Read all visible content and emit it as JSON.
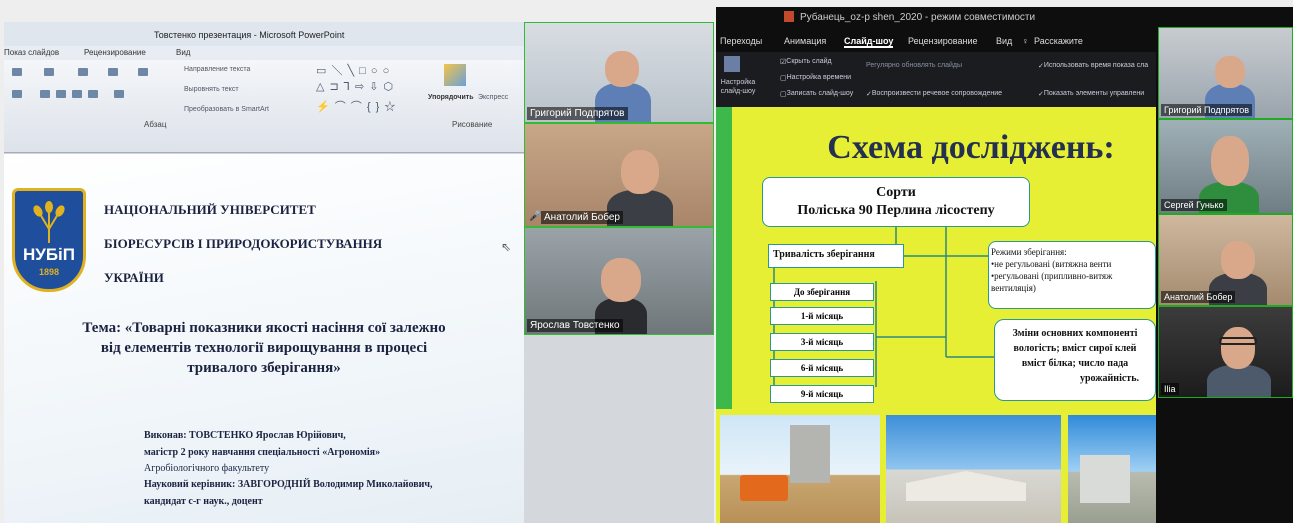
{
  "left": {
    "window_title": "Товстенко презентация  -  Microsoft PowerPoint",
    "tabs": [
      "Показ слайдов",
      "Рецензирование",
      "Вид"
    ],
    "ribbon": {
      "text_direction": "Направление текста",
      "align_text": "Выровнять текст",
      "convert_smartart": "Преобразовать в SmartArt",
      "arrange": "Упорядочить",
      "express": "Экспресс",
      "group_paragraph": "Абзац",
      "group_drawing": "Рисование"
    },
    "slide": {
      "logo_text": "НУБіП",
      "logo_year": "1898",
      "university_line1": "НАЦІОНАЛЬНИЙ УНІВЕРСИТЕТ",
      "university_line2": "БІОРЕСУРСІВ І ПРИРОДОКОРИСТУВАННЯ",
      "university_line3": "УКРАЇНИ",
      "topic_line1": "Тема: «Товарні показники якості насіння сої залежно",
      "topic_line2": "від елементів технології вирощування  в процесі",
      "topic_line3": "тривалого  зберігання»",
      "author_line1": "Виконав: ТОВСТЕНКО Ярослав Юрійович,",
      "author_line2": "магістр 2 року навчання спеціальності «Агрономія»",
      "author_line3": "Агробіологічного факультету",
      "author_line4": "Науковий керівник: ЗАВГОРОДНІЙ Володимир Миколайович,",
      "author_line5": "кандидат с-г наук., доцент"
    },
    "participants": [
      "Григорий Подпрятов",
      "Анатолий Бобер",
      "Ярослав Товстенко"
    ]
  },
  "right": {
    "window_title": "Рубанець_oz-p shen_2020  -  режим совместимости",
    "tabs": [
      "Переходы",
      "Анимация",
      "Слайд-шоу",
      "Рецензирование",
      "Вид",
      "Расскажите"
    ],
    "ribbon": {
      "setup_show": "Настройка слайд-шоу",
      "hide_slide": "Скрыть слайд",
      "rehearse": "Настройка времени",
      "record": "Записать слайд-шоу",
      "update_auto": "Регулярно обновлять слайды",
      "play_narration": "Воспроизвести речевое сопровождение",
      "use_timings": "Использовать время показа сла",
      "show_controls": "Показать элементы управлени"
    },
    "slide": {
      "title": "Схема досліджень:",
      "sorts_title": "Сорти",
      "sorts_line": "Поліська 90   Перлина лісостепу",
      "storage_duration": "Тривалість зберігання",
      "before_storage": "До зберігання",
      "months": [
        "1-й місяць",
        "3-й місяць",
        "6-й місяць",
        "9-й місяць"
      ],
      "modes_title": "Режими зберігання:",
      "mode1": "•не регульовані (витяжна венти",
      "mode2": "•регульовані (припливно-витяж",
      "mode3": "вентиляція)",
      "changes_line1": "Зміни основних компоненті",
      "changes_line2": "вологість; вміст сирої клей",
      "changes_line3": "вміст білка; число пада",
      "changes_line4": "урожайність."
    },
    "participants": [
      "Григорий Подпрятов",
      "Сергей Гунько",
      "Анатолий Бобер",
      "Ilia"
    ]
  }
}
